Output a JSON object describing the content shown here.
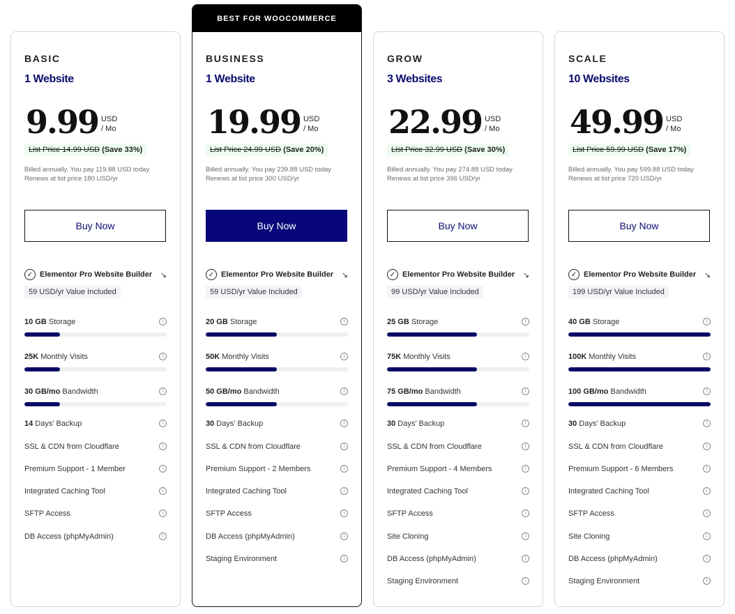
{
  "buy_label": "Buy Now",
  "builder_label": "Elementor Pro Website Builder",
  "colors": {
    "brand": "#07077a",
    "meter_fill": "#0a0a66",
    "save_bg": "#eefbf1"
  },
  "plans": [
    {
      "name": "BASIC",
      "sites": "1 Website",
      "price": "9.99",
      "currency": "USD",
      "period": "/ Mo",
      "list_price": "List Price 14.99 USD",
      "save": "(Save 33%)",
      "billed": "Billed annually. You pay 119.88 USD today",
      "renews": "Renews at list price 180 USD/yr",
      "value_included": "59 USD/yr Value Included",
      "meters": [
        {
          "amount": "10 GB",
          "label": "Storage",
          "fill_pct": 25
        },
        {
          "amount": "25K",
          "label": "Monthly Visits",
          "fill_pct": 25
        },
        {
          "amount": "30 GB/mo",
          "label": "Bandwidth",
          "fill_pct": 25
        }
      ],
      "features": [
        {
          "bold": "14",
          "text": " Days' Backup"
        },
        {
          "bold": "",
          "text": "SSL & CDN from Cloudflare"
        },
        {
          "bold": "",
          "text": "Premium Support - 1 Member"
        },
        {
          "bold": "",
          "text": "Integrated Caching Tool"
        },
        {
          "bold": "",
          "text": "SFTP Access"
        },
        {
          "bold": "",
          "text": "DB Access (phpMyAdmin)"
        }
      ]
    },
    {
      "name": "BUSINESS",
      "ribbon": "BEST FOR WOOCOMMERCE",
      "sites": "1 Website",
      "price": "19.99",
      "currency": "USD",
      "period": "/ Mo",
      "list_price": "List Price 24.99 USD",
      "save": "(Save 20%)",
      "billed": "Billed annually. You pay 239.88 USD today",
      "renews": "Renews at list price 300 USD/yr",
      "value_included": "59 USD/yr Value Included",
      "meters": [
        {
          "amount": "20 GB",
          "label": "Storage",
          "fill_pct": 50
        },
        {
          "amount": "50K",
          "label": "Monthly Visits",
          "fill_pct": 50
        },
        {
          "amount": "50 GB/mo",
          "label": "Bandwidth",
          "fill_pct": 50
        }
      ],
      "features": [
        {
          "bold": "30",
          "text": " Days' Backup"
        },
        {
          "bold": "",
          "text": "SSL & CDN from Cloudflare"
        },
        {
          "bold": "",
          "text": "Premium Support - 2 Members"
        },
        {
          "bold": "",
          "text": "Integrated Caching Tool"
        },
        {
          "bold": "",
          "text": "SFTP Access"
        },
        {
          "bold": "",
          "text": "DB Access (phpMyAdmin)"
        },
        {
          "bold": "",
          "text": "Staging Environment"
        }
      ]
    },
    {
      "name": "GROW",
      "sites": "3 Websites",
      "price": "22.99",
      "currency": "USD",
      "period": "/ Mo",
      "list_price": "List Price 32.99 USD",
      "save": "(Save 30%)",
      "billed": "Billed annually. You pay 274.88 USD today",
      "renews": "Renews at list price 396 USD/yr",
      "value_included": "99 USD/yr Value Included",
      "meters": [
        {
          "amount": "25 GB",
          "label": "Storage",
          "fill_pct": 63
        },
        {
          "amount": "75K",
          "label": "Monthly Visits",
          "fill_pct": 63
        },
        {
          "amount": "75 GB/mo",
          "label": "Bandwidth",
          "fill_pct": 63
        }
      ],
      "features": [
        {
          "bold": "30",
          "text": " Days' Backup"
        },
        {
          "bold": "",
          "text": "SSL & CDN from Cloudflare"
        },
        {
          "bold": "",
          "text": "Premium Support - 4 Members"
        },
        {
          "bold": "",
          "text": "Integrated Caching Tool"
        },
        {
          "bold": "",
          "text": "SFTP Access"
        },
        {
          "bold": "",
          "text": "Site Cloning"
        },
        {
          "bold": "",
          "text": "DB Access (phpMyAdmin)"
        },
        {
          "bold": "",
          "text": "Staging Environment"
        }
      ]
    },
    {
      "name": "SCALE",
      "sites": "10 Websites",
      "price": "49.99",
      "currency": "USD",
      "period": "/ Mo",
      "list_price": "List Price 59.99 USD",
      "save": "(Save 17%)",
      "billed": "Billed annually. You pay 599.88 USD today",
      "renews": "Renews at list price 720 USD/yr",
      "value_included": "199 USD/yr Value Included",
      "meters": [
        {
          "amount": "40 GB",
          "label": "Storage",
          "fill_pct": 100
        },
        {
          "amount": "100K",
          "label": "Monthly Visits",
          "fill_pct": 100
        },
        {
          "amount": "100 GB/mo",
          "label": "Bandwidth",
          "fill_pct": 100
        }
      ],
      "features": [
        {
          "bold": "30",
          "text": " Days' Backup"
        },
        {
          "bold": "",
          "text": "SSL & CDN from Cloudflare"
        },
        {
          "bold": "",
          "text": "Premium Support - 6 Members"
        },
        {
          "bold": "",
          "text": "Integrated Caching Tool"
        },
        {
          "bold": "",
          "text": "SFTP Access"
        },
        {
          "bold": "",
          "text": "Site Cloning"
        },
        {
          "bold": "",
          "text": "DB Access (phpMyAdmin)"
        },
        {
          "bold": "",
          "text": "Staging Environment"
        }
      ]
    }
  ]
}
